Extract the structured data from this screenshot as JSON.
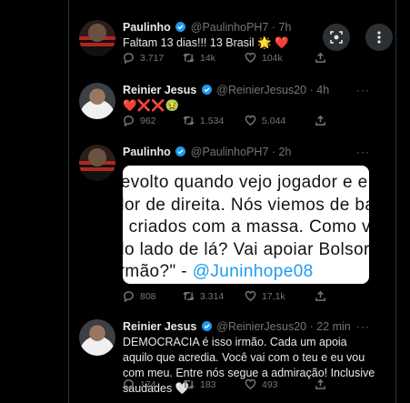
{
  "tweets": [
    {
      "name": "Paulinho",
      "handle": "@PaulinhoPH7",
      "time": "· 7h",
      "text": "Faltam 13 dias!!! 13 Brasil 🌟 ❤️",
      "replies": "3.717",
      "retweets": "14k",
      "likes": "104k"
    },
    {
      "name": "Reinier Jesus",
      "handle": "@ReinierJesus20",
      "time": "· 4h",
      "text": "❤️❌❌🤢",
      "replies": "962",
      "retweets": "1.534",
      "likes": "5.044"
    },
    {
      "name": "Paulinho",
      "handle": "@PaulinhoPH7",
      "time": "· 2h",
      "media_lines": [
        "revolto quando vejo jogador e e",
        "dor de direita. Nós viemos de ba",
        "s criados com a massa. Como v",
        "do lado de lá? Vai apoiar Bolsor",
        "irmão?\" - "
      ],
      "media_link": "@Juninhope08",
      "replies": "808",
      "retweets": "3.314",
      "likes": "17,1k"
    },
    {
      "name": "Reinier Jesus",
      "handle": "@ReinierJesus20",
      "time": "· 22 min",
      "text": "DEMOCRACIA é isso irmão. Cada um apoia aquilo que acredia. Você vai com o teu e eu vou com meu. Entre nós segue a admiração! Inclusive saudades 🤍",
      "replies": "174",
      "retweets": "183",
      "likes": "493"
    }
  ],
  "more_label": "···",
  "colors": {
    "background": "#000000",
    "muted": "#71767b",
    "link": "#1d9bf0",
    "verified": "#1d9bf0"
  },
  "icons": {
    "reply": "reply-icon",
    "retweet": "retweet-icon",
    "like": "like-icon",
    "share": "share-icon",
    "lens": "lens-icon",
    "more": "more-vertical-icon"
  }
}
